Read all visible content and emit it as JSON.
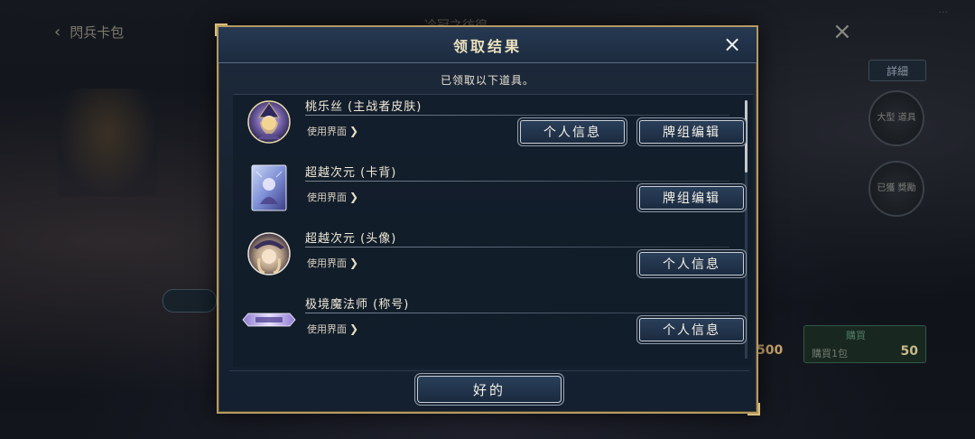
{
  "background": {
    "back_label": "閃兵卡包",
    "title_label": "冷冠之彷徨",
    "corner_label": "...",
    "right_tab": "詳細",
    "circle1": "大型 道具",
    "circle2": "已獲 獎勵",
    "price_title": "購買",
    "price_left_label": "購買1包",
    "price_value": "50",
    "price_secondary": "500"
  },
  "modal": {
    "title": "领取结果",
    "close_icon": "×",
    "subtitle": "已领取以下道具。",
    "items": [
      {
        "name": "桃乐丝 (主战者皮肤)",
        "link": "使用界面",
        "thumb": "avatar-witch",
        "buttons": [
          "个人信息",
          "牌组编辑"
        ]
      },
      {
        "name": "超越次元 (卡背)",
        "link": "使用界面",
        "thumb": "card-back",
        "buttons": [
          "牌组编辑"
        ]
      },
      {
        "name": "超越次元 (头像)",
        "link": "使用界面",
        "thumb": "avatar-circle",
        "buttons": [
          "个人信息"
        ]
      },
      {
        "name": "极境魔法师 (称号)",
        "link": "使用界面",
        "thumb": "title-badge",
        "buttons": [
          "个人信息"
        ]
      }
    ],
    "ok_label": "好的"
  },
  "icons": {
    "chevron": "❯",
    "back_arrow": "‹"
  }
}
